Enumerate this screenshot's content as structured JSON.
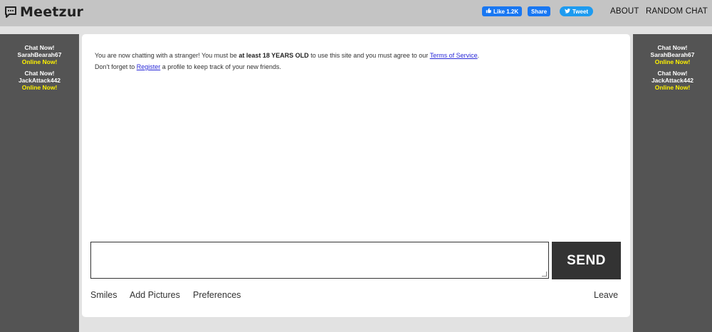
{
  "header": {
    "logo_text": "Meetzur",
    "fb_like_label": "Like 1.2K",
    "fb_share_label": "Share",
    "tweet_label": "Tweet",
    "nav": {
      "about": "ABOUT",
      "random_chat": "RANDOM CHAT"
    }
  },
  "side_promos": [
    {
      "cta": "Chat Now!",
      "username": "SarahBearah67",
      "status": "Online Now!"
    },
    {
      "cta": "Chat Now!",
      "username": "JackAttack442",
      "status": "Online Now!"
    }
  ],
  "notice": {
    "line1_pre": "You are now chatting with a stranger! You must be ",
    "line1_bold": "at least 18 YEARS OLD",
    "line1_mid": " to use this site and you must agree to our ",
    "line1_link": "Terms of Service",
    "line1_end": ".",
    "line2_pre": "Don't forget to ",
    "line2_link": "Register",
    "line2_end": " a profile to keep track of your new friends."
  },
  "composer": {
    "message_value": "",
    "send_label": "SEND"
  },
  "footer_links": {
    "smiles": "Smiles",
    "add_pictures": "Add Pictures",
    "preferences": "Preferences",
    "leave": "Leave"
  },
  "colors": {
    "header_bg": "#c4c4c4",
    "side_bg": "#545454",
    "online_yellow": "#fff200",
    "facebook_blue": "#1877f2",
    "twitter_blue": "#1d9bf0",
    "send_bg": "#333333"
  },
  "icons": {
    "logo": "speech-bubble-icon",
    "fb_like": "thumbs-up-icon",
    "tweet": "twitter-bird-icon"
  }
}
